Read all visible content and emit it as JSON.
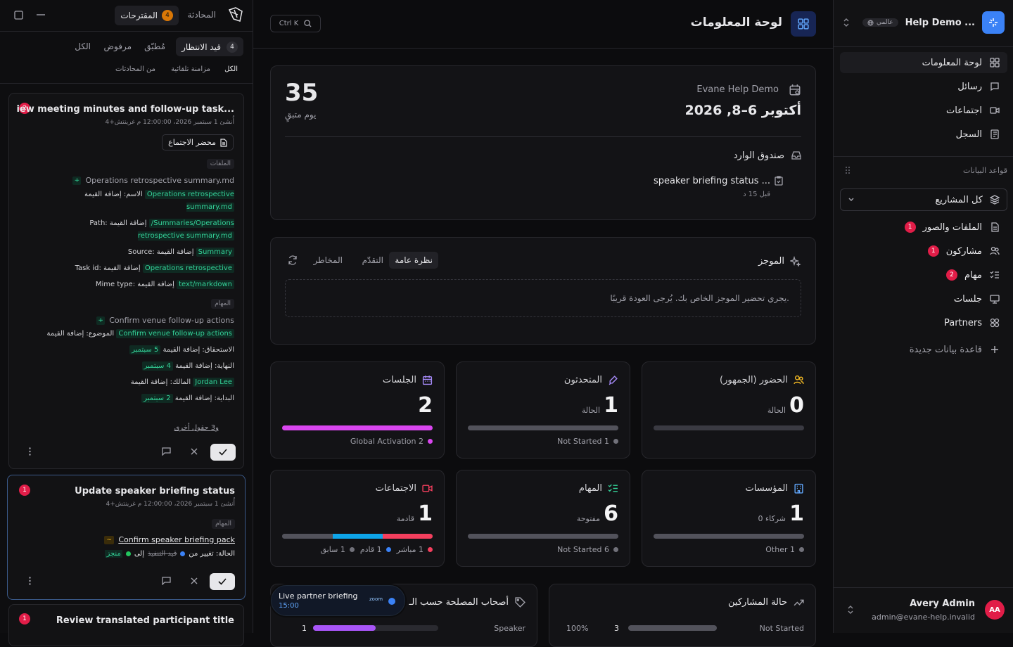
{
  "sidebar": {
    "workspace_name": "Help Demo ...",
    "workspace_badge": "عالمي",
    "nav": [
      {
        "label": "لوحة المعلومات",
        "icon": "dashboard-icon"
      },
      {
        "label": "رسائل",
        "icon": "message-icon"
      },
      {
        "label": "اجتماعات",
        "icon": "video-icon"
      },
      {
        "label": "السجل",
        "icon": "log-icon"
      }
    ],
    "databases_heading": "قواعد البيانات",
    "projects_select": "كل المشاريع",
    "db_items": [
      {
        "label": "الملفات والصور",
        "badge": "1",
        "icon": "file-icon"
      },
      {
        "label": "مشاركون",
        "badge": "1",
        "icon": "users-icon"
      },
      {
        "label": "مهام",
        "badge": "2",
        "icon": "tasks-icon"
      },
      {
        "label": "جلسات",
        "badge": "",
        "icon": "presentation-icon"
      },
      {
        "label": "Partners",
        "badge": "",
        "icon": "partners-icon"
      }
    ],
    "new_db": "قاعدة بيانات جديدة",
    "user": {
      "name": "Avery Admin",
      "email": "admin@evane-help.invalid",
      "initials": "AA"
    }
  },
  "header": {
    "title": "لوحة المعلومات",
    "shortcut": "Ctrl K"
  },
  "event_card": {
    "days_num": "35",
    "days_label": "يوم متبقٍ",
    "org": "Evane Help Demo",
    "dates": "أكتوبر 6–8, 2026",
    "inbox_title": "صندوق الوارد",
    "inbox_item": "speaker briefing status ...",
    "inbox_time": "قبل 15 د"
  },
  "brief": {
    "title": "الموجز",
    "tabs": [
      "نظرة عامة",
      "التقدّم",
      "المخاطر"
    ],
    "message": "يجري تحضير الموجز الخاص بك. يُرجى العودة قريبًا."
  },
  "kpis": [
    {
      "label": "الحضور (الجمهور)",
      "icon": "audience-icon",
      "icon_color": "#fbbf24",
      "num": "0",
      "sub": "الحالة",
      "legend": [],
      "bar": []
    },
    {
      "label": "المتحدثون",
      "icon": "mic-icon",
      "icon_color": "#a78bfa",
      "num": "1",
      "sub": "الحالة",
      "legend": [
        {
          "text": "1 Not Started",
          "color": "#71717a"
        }
      ],
      "bar": [
        {
          "frac": 1.0,
          "color": "#52525b"
        }
      ]
    },
    {
      "label": "الجلسات",
      "icon": "calendar-icon",
      "icon_color": "#a78bfa",
      "num": "2",
      "sub": "",
      "legend": [
        {
          "text": "2 Global Activation",
          "color": "#d946ef"
        }
      ],
      "bar": [
        {
          "frac": 1.0,
          "color": "#d946ef"
        }
      ]
    },
    {
      "label": "المؤسسات",
      "icon": "building-icon",
      "icon_color": "#60a5fa",
      "num": "1",
      "sub": "0 شركاء",
      "legend": [
        {
          "text": "1 Other",
          "color": "#71717a"
        }
      ],
      "bar": [
        {
          "frac": 1.0,
          "color": "#52525b"
        }
      ]
    },
    {
      "label": "المهام",
      "icon": "checklist-icon",
      "icon_color": "#34d399",
      "num": "6",
      "sub": "مفتوحة",
      "legend": [
        {
          "text": "6 Not Started",
          "color": "#71717a"
        }
      ],
      "bar": [
        {
          "frac": 1.0,
          "color": "#52525b"
        }
      ]
    },
    {
      "label": "الاجتماعات",
      "icon": "camera-icon",
      "icon_color": "#f43f5e",
      "num": "1",
      "sub": "قادمة",
      "legend": [
        {
          "text": "1 مباشر",
          "color": "#f43f5e"
        },
        {
          "text": "1 قادم",
          "color": "#3b82f6"
        },
        {
          "text": "1 سابق",
          "color": "#71717a"
        }
      ],
      "bar": [
        {
          "frac": 0.333,
          "color": "#f43f5e"
        },
        {
          "frac": 0.333,
          "color": "#0ea5e9"
        },
        {
          "frac": 0.334,
          "color": "#52525b"
        }
      ]
    }
  ],
  "bottom": {
    "stakeholders_title": "أصحاب المصلحة حسب الـ",
    "stakeholder_row": {
      "label": "Speaker",
      "value": "1",
      "frac": 0.5
    },
    "participants_title": "حالة المشاركين",
    "participant_row": {
      "label": "Not Started",
      "value": "3",
      "pct": "100%",
      "frac": 1.0
    }
  },
  "live": {
    "title": "Live partner briefing",
    "time": "15:00",
    "provider": "zoom"
  },
  "left": {
    "tabs": {
      "chat": "المحادثة",
      "suggestions": "المقترحات",
      "suggestions_count": "4"
    },
    "filters": [
      "قيد الانتظار",
      "مُطبّق",
      "مرفوض",
      "الكل"
    ],
    "pending_count": "4",
    "sources": [
      "الكل",
      "مزامنة تلقائية",
      "من المحادثات"
    ],
    "card1": {
      "badge": "2",
      "title": "iew meeting minutes and follow-up task...",
      "meta": "أُنشئ 1 سبتمبر 2026، 12:00:00 م غرينتش+4",
      "doc_button": "محضر الاجتماع",
      "files_tag": "الملفات",
      "file_title": "Operations retrospective summary.md",
      "fields": [
        {
          "label": "الاسم: إضافة القيمة",
          "value": "Operations retrospective summary.md"
        },
        {
          "label": "Path: إضافة القيمة",
          "value": "/Summaries/Operations retrospective summary.md"
        },
        {
          "label": "Source: إضافة القيمة",
          "value": "Summary"
        },
        {
          "label": "Task id: إضافة القيمة",
          "value": "Operations retrospective"
        },
        {
          "label": "Mime type: إضافة القيمة",
          "value": "text/markdown"
        }
      ],
      "tasks_tag": "المهام",
      "task_title": "Confirm venue follow-up actions",
      "task_fields": [
        {
          "label": "الموضوع: إضافة القيمة",
          "value": "Confirm venue follow-up actions"
        },
        {
          "label": "الاستحقاق: إضافة القيمة",
          "value": "5 سبتمبر"
        },
        {
          "label": "النهاية: إضافة القيمة",
          "value": "4 سبتمبر"
        },
        {
          "label": "المالك: إضافة القيمة",
          "value": "Jordan Lee"
        },
        {
          "label": "البداية: إضافة القيمة",
          "value": "2 سبتمبر"
        }
      ],
      "more": "و3 حقول أخرى"
    },
    "card2": {
      "badge": "1",
      "title": "Update speaker briefing status",
      "meta": "أُنشئ 1 سبتمبر 2026، 12:00:00 م غرينتش+4",
      "tasks_tag": "المهام",
      "task_link": "Confirm speaker briefing pack",
      "change_label": "الحالة: تغيير من",
      "old": "قيد التنفيذ",
      "to": "إلى",
      "new": "منجز"
    },
    "card3": {
      "badge": "1",
      "title": "Review translated participant title"
    }
  }
}
